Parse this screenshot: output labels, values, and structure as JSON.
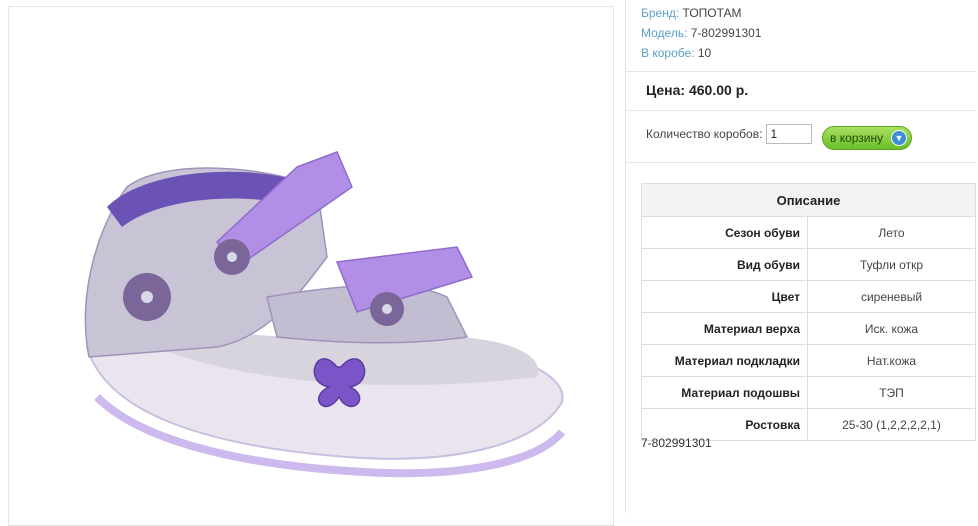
{
  "product": {
    "image_alt": "Детские сандалии, сиреневые",
    "meta": [
      {
        "label": "Бренд:",
        "value": "ТОПОТАМ"
      },
      {
        "label": "Модель:",
        "value": "7-802991301"
      },
      {
        "label": "В коробе:",
        "value": "10"
      }
    ],
    "price_label": "Цена: 460.00 р.",
    "quantity_label": "Количество коробов:",
    "quantity_value": "1",
    "cart_button_label": "в корзину",
    "cart_icon": "arrow-down-circle-icon",
    "description_title": "Описание",
    "attributes": [
      {
        "name": "Сезон обуви",
        "value": "Лето"
      },
      {
        "name": "Вид обуви",
        "value": "Туфли откр"
      },
      {
        "name": "Цвет",
        "value": "сиреневый"
      },
      {
        "name": "Материал верха",
        "value": "Иск. кожа"
      },
      {
        "name": "Материал подкладки",
        "value": "Нат.кожа"
      },
      {
        "name": "Материал подошвы",
        "value": "ТЭП"
      },
      {
        "name": "Ростовка",
        "value": "25-30 (1,2,2,2,2,1)"
      }
    ],
    "sku_footer": "7-802991301"
  },
  "colors": {
    "link": "#5aa0c9",
    "button": "#7cc43a",
    "sandal": "#9b7fd9"
  }
}
